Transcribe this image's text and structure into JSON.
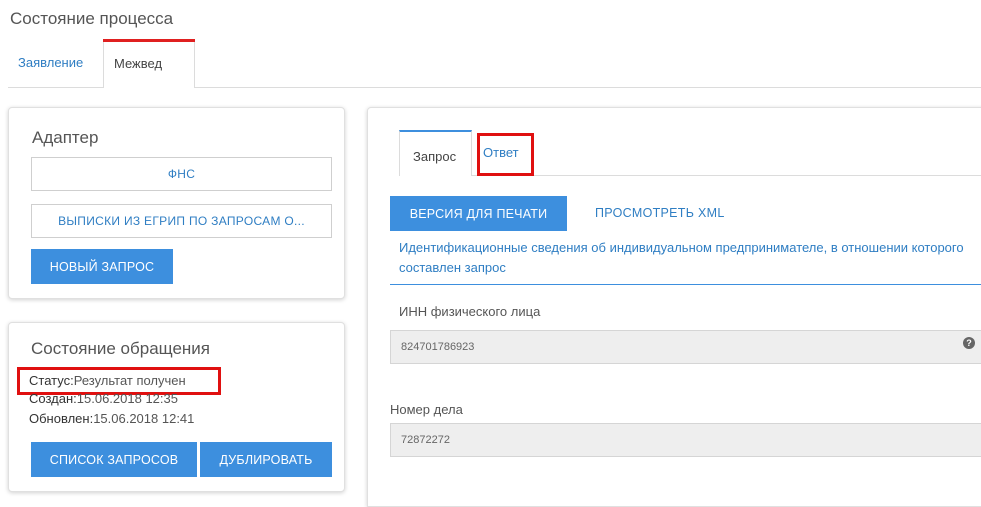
{
  "page": {
    "title": "Состояние процесса"
  },
  "tabs": [
    {
      "label": "Заявление"
    },
    {
      "label": "Межвед"
    }
  ],
  "adapter": {
    "title": "Адаптер",
    "service": "ФНС",
    "request_type": "ВЫПИСКИ ИЗ ЕГРИП ПО ЗАПРОСАМ О...",
    "new_request_label": "НОВЫЙ ЗАПРОС"
  },
  "request_state": {
    "title": "Состояние обращения",
    "status_label": "Статус:",
    "status_value": "Результат получен",
    "created_label": "Создан:",
    "created_value": "15.06.2018 12:35",
    "updated_label": "Обновлен:",
    "updated_value": "15.06.2018 12:41",
    "list_button": "СПИСОК ЗАПРОСОВ",
    "duplicate_button": "ДУБЛИРОВАТЬ"
  },
  "detail": {
    "tabs": [
      {
        "label": "Запрос"
      },
      {
        "label": "Ответ"
      }
    ],
    "print_button": "ВЕРСИЯ ДЛЯ ПЕЧАТИ",
    "xml_link": "ПРОСМОТРЕТЬ XML",
    "section_title": "Идентификационные сведения об индивидуальном предпринимателе, в отношении которого составлен запрос",
    "fields": [
      {
        "label": "ИНН физического лица",
        "value": "824701786923"
      },
      {
        "label": "Номер дела",
        "value": "72872272"
      }
    ]
  },
  "colors": {
    "primary": "#3d8fde",
    "link": "#2f7ec3",
    "highlight": "#e01010"
  }
}
